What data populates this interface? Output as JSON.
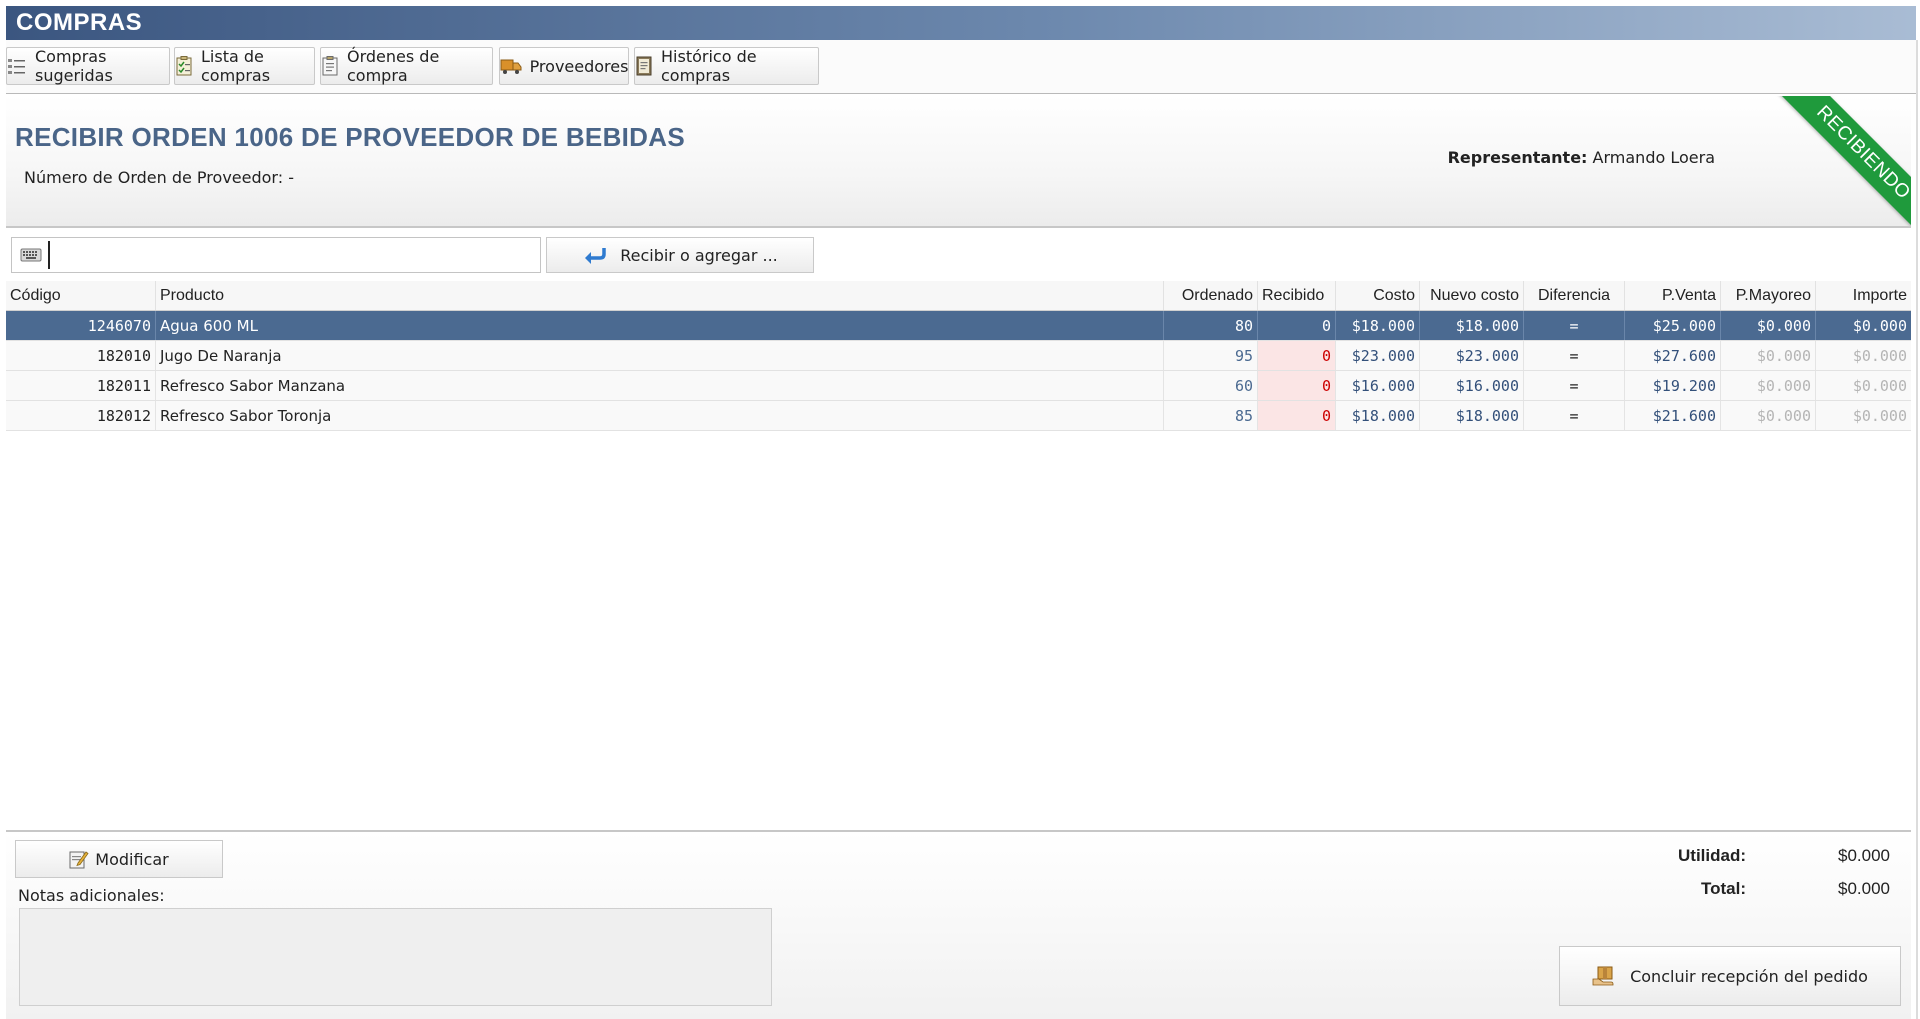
{
  "app": {
    "title": "COMPRAS"
  },
  "tabs": [
    {
      "label": "Compras sugeridas",
      "icon": "suggested-list-icon"
    },
    {
      "label": "Lista de compras",
      "icon": "checklist-icon"
    },
    {
      "label": "Órdenes de compra",
      "icon": "clipboard-icon"
    },
    {
      "label": "Proveedores",
      "icon": "truck-icon"
    },
    {
      "label": "Histórico de compras",
      "icon": "history-book-icon"
    }
  ],
  "order": {
    "title": "RECIBIR ORDEN 1006 DE PROVEEDOR DE BEBIDAS",
    "supplier_order_text": "Número de Orden de Proveedor: -",
    "rep_label": "Representante:",
    "rep_name": "Armando Loera",
    "status_ribbon": "RECIBIENDO"
  },
  "scan": {
    "value": "",
    "button_label": "Recibir o agregar ..."
  },
  "table": {
    "headers": {
      "code": "Código",
      "product": "Producto",
      "ordered": "Ordenado",
      "received": "Recibido",
      "cost": "Costo",
      "new_cost": "Nuevo costo",
      "difference": "Diferencia",
      "sale_price": "P.Venta",
      "wholesale": "P.Mayoreo",
      "amount": "Importe"
    },
    "rows": [
      {
        "code": "1246070",
        "product": "Agua 600 ML",
        "ordered": "80",
        "received": "0",
        "cost": "$18.000",
        "new_cost": "$18.000",
        "difference": "=",
        "sale_price": "$25.000",
        "wholesale": "$0.000",
        "amount": "$0.000"
      },
      {
        "code": "182010",
        "product": "Jugo De Naranja",
        "ordered": "95",
        "received": "0",
        "cost": "$23.000",
        "new_cost": "$23.000",
        "difference": "=",
        "sale_price": "$27.600",
        "wholesale": "$0.000",
        "amount": "$0.000"
      },
      {
        "code": "182011",
        "product": "Refresco Sabor Manzana",
        "ordered": "60",
        "received": "0",
        "cost": "$16.000",
        "new_cost": "$16.000",
        "difference": "=",
        "sale_price": "$19.200",
        "wholesale": "$0.000",
        "amount": "$0.000"
      },
      {
        "code": "182012",
        "product": "Refresco Sabor Toronja",
        "ordered": "85",
        "received": "0",
        "cost": "$18.000",
        "new_cost": "$18.000",
        "difference": "=",
        "sale_price": "$21.600",
        "wholesale": "$0.000",
        "amount": "$0.000"
      }
    ]
  },
  "footer": {
    "modify_label": "Modificar",
    "notes_label": "Notas adicionales:",
    "notes_value": "",
    "utility_label": "Utilidad:",
    "utility_value": "$0.000",
    "total_label": "Total:",
    "total_value": "$0.000",
    "conclude_label": "Concluir recepción del pedido"
  },
  "colors": {
    "title_bar": "#3b5680",
    "heading": "#4a6588",
    "selected_row": "#4b6a91",
    "status_ribbon": "#1f9a3c",
    "received_cell": "#fbe5e5"
  }
}
